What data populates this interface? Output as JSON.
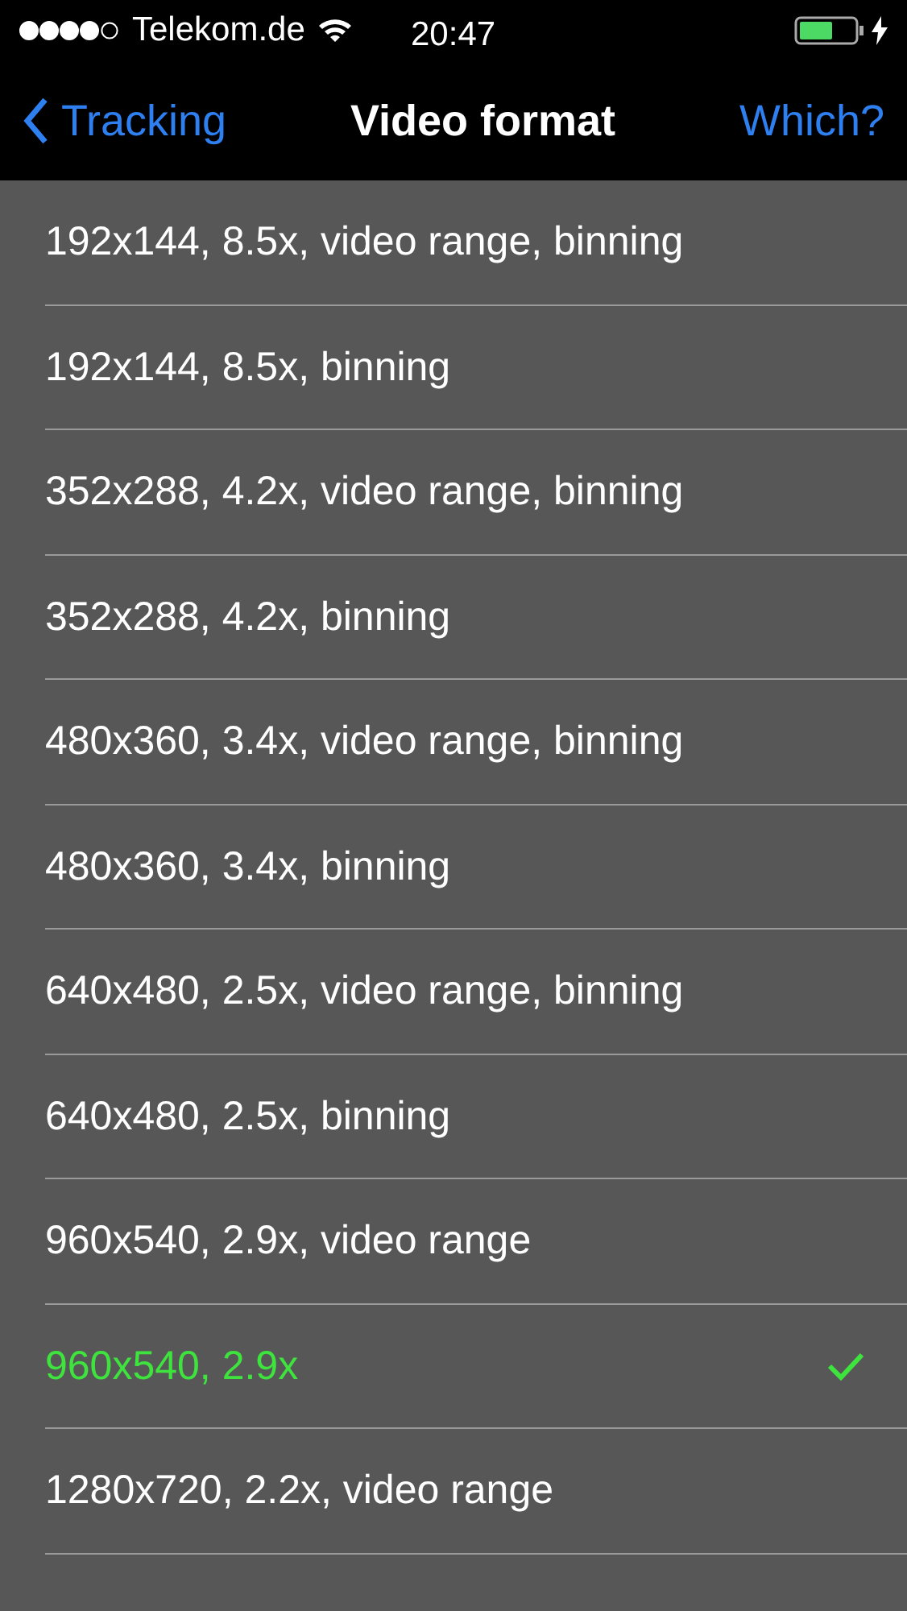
{
  "status_bar": {
    "carrier": "Telekom.de",
    "time": "20:47"
  },
  "nav": {
    "back": "Tracking",
    "title": "Video format",
    "action": "Which?"
  },
  "formats": [
    {
      "label": "192x144, 8.5x, video range, binning",
      "selected": false
    },
    {
      "label": "192x144, 8.5x, binning",
      "selected": false
    },
    {
      "label": "352x288, 4.2x, video range, binning",
      "selected": false
    },
    {
      "label": "352x288, 4.2x, binning",
      "selected": false
    },
    {
      "label": "480x360, 3.4x, video range, binning",
      "selected": false
    },
    {
      "label": "480x360, 3.4x, binning",
      "selected": false
    },
    {
      "label": "640x480, 2.5x, video range, binning",
      "selected": false
    },
    {
      "label": "640x480, 2.5x, binning",
      "selected": false
    },
    {
      "label": "960x540, 2.9x, video range",
      "selected": false
    },
    {
      "label": "960x540, 2.9x",
      "selected": true
    },
    {
      "label": "1280x720, 2.2x, video range",
      "selected": false
    }
  ]
}
